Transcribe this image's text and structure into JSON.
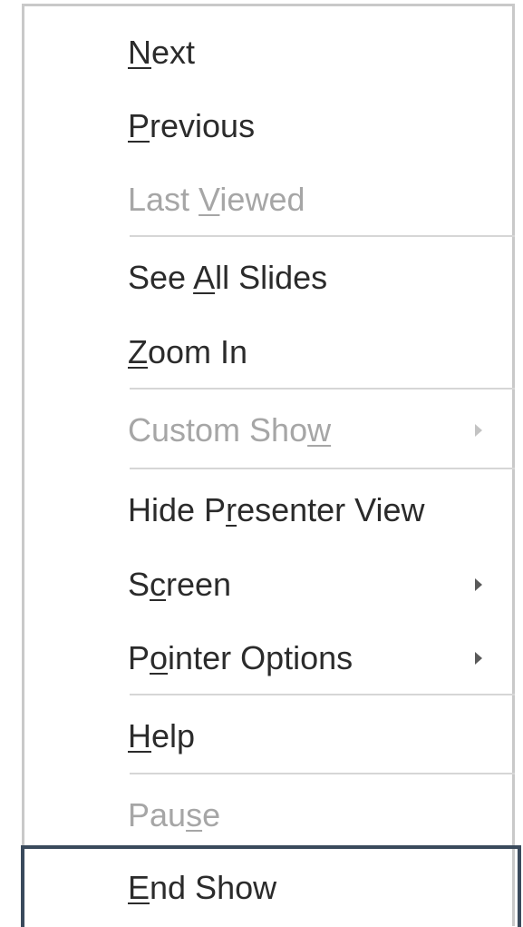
{
  "menu": {
    "items": [
      {
        "pre": "",
        "u": "N",
        "post": "ext",
        "disabled": false,
        "submenu": false
      },
      {
        "pre": "",
        "u": "P",
        "post": "revious",
        "disabled": false,
        "submenu": false
      },
      {
        "pre": "Last ",
        "u": "V",
        "post": "iewed",
        "disabled": true,
        "submenu": false
      },
      {
        "pre": "See ",
        "u": "A",
        "post": "ll Slides",
        "disabled": false,
        "submenu": false
      },
      {
        "pre": "",
        "u": "Z",
        "post": "oom In",
        "disabled": false,
        "submenu": false
      },
      {
        "pre": "Custom Sho",
        "u": "w",
        "post": "",
        "disabled": true,
        "submenu": true
      },
      {
        "pre": "Hide P",
        "u": "r",
        "post": "esenter View",
        "disabled": false,
        "submenu": false
      },
      {
        "pre": "S",
        "u": "c",
        "post": "reen",
        "disabled": false,
        "submenu": true
      },
      {
        "pre": "P",
        "u": "o",
        "post": "inter Options",
        "disabled": false,
        "submenu": true
      },
      {
        "pre": "",
        "u": "H",
        "post": "elp",
        "disabled": false,
        "submenu": false
      },
      {
        "pre": "Pau",
        "u": "s",
        "post": "e",
        "disabled": true,
        "submenu": false
      },
      {
        "pre": "",
        "u": "E",
        "post": "nd Show",
        "disabled": false,
        "submenu": false,
        "selected": true
      }
    ]
  }
}
